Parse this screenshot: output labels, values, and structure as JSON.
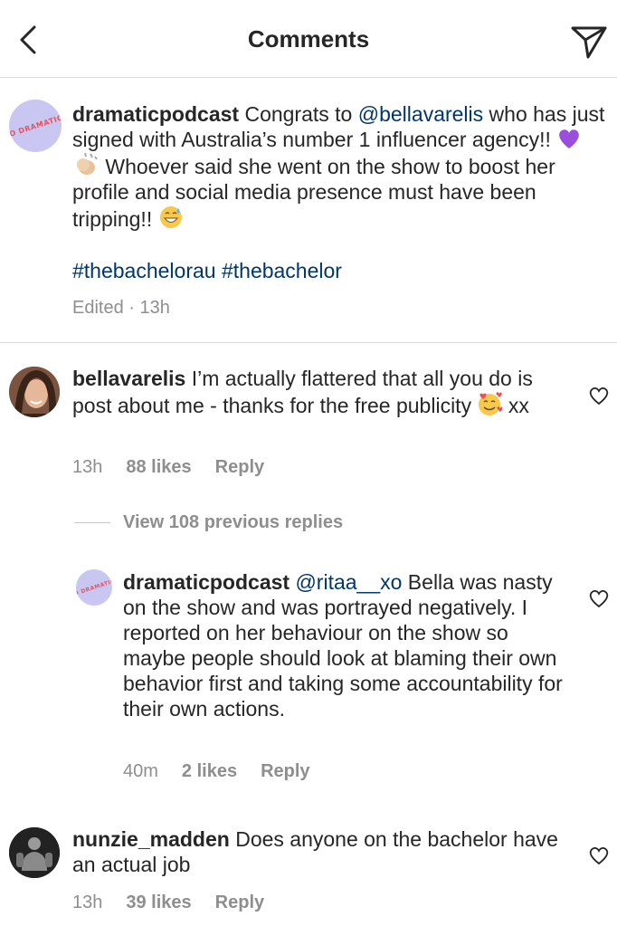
{
  "header": {
    "title": "Comments",
    "back_icon": "chevron-left-icon",
    "send_icon": "paper-plane-icon"
  },
  "caption": {
    "username": "dramaticpodcast",
    "avatar_text": "SO DRAMATIC!",
    "text_1": " Congrats to ",
    "mention": "@bellavarelis",
    "text_2": " who has just signed with Australia’s number 1 influencer agency!! ",
    "emoji_1": "purple-heart-icon",
    "emoji_2": "clapping-hands-icon",
    "text_3": " Whoever said she went on the show to boost her profile and social media presence must have been tripping!! ",
    "emoji_3": "grinning-sweat-icon",
    "hashtags": "#thebachelorau #thebachelor",
    "meta": "Edited · 13h"
  },
  "comments": [
    {
      "username": "bellavarelis",
      "text_1": " I’m actually flattered that all you do is post about me - thanks for the free publicity ",
      "emoji": "smiling-face-with-hearts-icon",
      "text_2": " xx",
      "time": "13h",
      "likes": "88 likes",
      "reply": "Reply"
    },
    {
      "username": "dramaticpodcast",
      "mention": "@ritaa__xo",
      "text": " Bella was nasty on the show and was portrayed negatively. I reported on her behaviour on the show so maybe people should look at blaming their own behavior first and taking some accountability for their own actions.",
      "time": "40m",
      "likes": "2 likes",
      "reply": "Reply"
    },
    {
      "username": "nunzie_madden",
      "text": " Does anyone on the bachelor have an actual job",
      "time": "13h",
      "likes": "39 likes",
      "reply": "Reply"
    }
  ],
  "view_replies": "View 108 previous replies",
  "colors": {
    "link": "#00376b",
    "muted": "#8e8e8e",
    "divider": "#dbdbdb"
  }
}
